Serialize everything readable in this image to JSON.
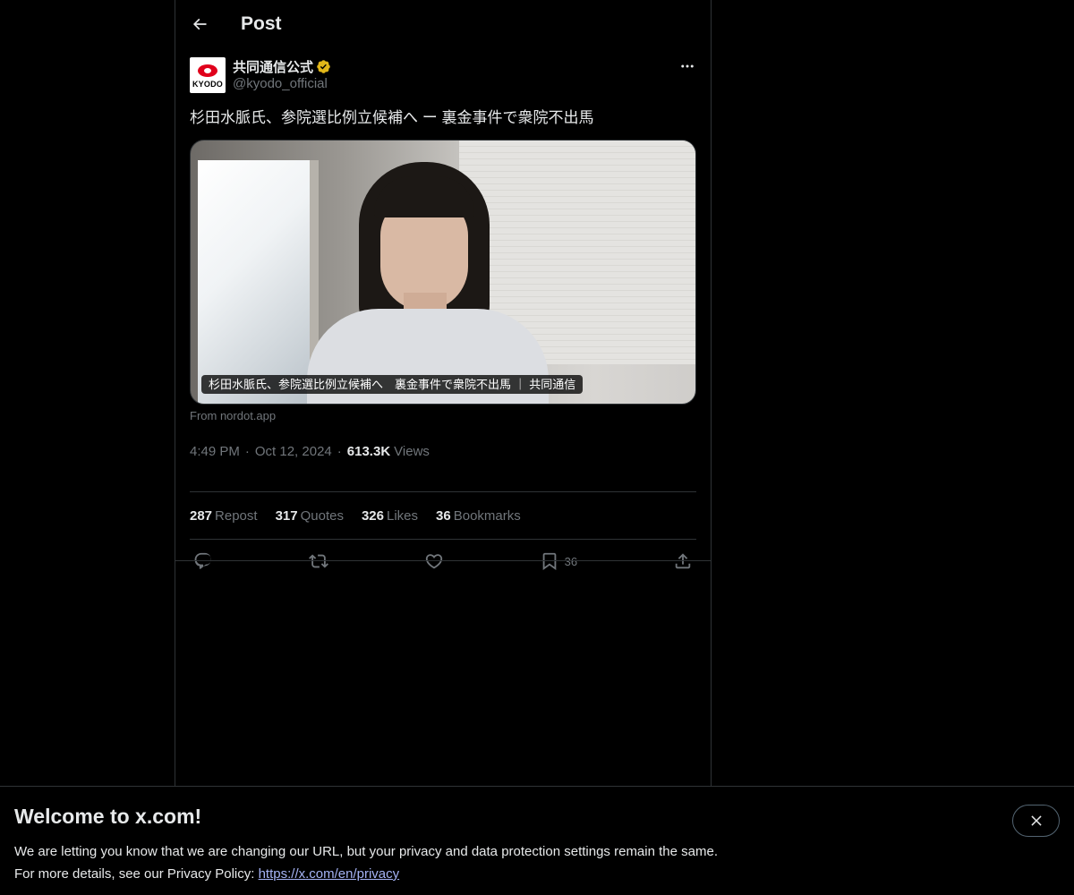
{
  "header": {
    "title": "Post"
  },
  "post": {
    "author": {
      "display_name": "共同通信公式",
      "handle": "@kyodo_official",
      "avatar_text": "KYODO"
    },
    "text": "杉田水脈氏、参院選比例立候補へ ー 裏金事件で衆院不出馬",
    "media": {
      "caption": "杉田水脈氏、参院選比例立候補へ　裏金事件で衆院不出馬 ｜ 共同通信",
      "source": "From nordot.app"
    },
    "time": "4:49 PM",
    "date": "Oct 12, 2024",
    "dot": "·",
    "views_count": "613.3K",
    "views_label": "Views",
    "stats": [
      {
        "num": "287",
        "label": "Repost"
      },
      {
        "num": "317",
        "label": "Quotes"
      },
      {
        "num": "326",
        "label": "Likes"
      },
      {
        "num": "36",
        "label": "Bookmarks"
      }
    ],
    "bookmark_count": "36"
  },
  "banner": {
    "title": "Welcome to x.com!",
    "line1": "We are letting you know that we are changing our URL, but your privacy and data protection settings remain the same.",
    "line2_prefix": "For more details, see our Privacy Policy: ",
    "link": "https://x.com/en/privacy"
  },
  "colors": {
    "background": "#000000",
    "text": "#e7e9ea",
    "muted": "#71767b",
    "border": "#2f3336",
    "verified_gold": "#e2b719",
    "link": "#a5b3f5"
  },
  "icons": {
    "back": "arrow-left-icon",
    "more": "more-horizontal-icon",
    "verified": "verified-badge-icon",
    "reply": "reply-icon",
    "repost": "repost-icon",
    "like": "heart-icon",
    "bookmark": "bookmark-icon",
    "share": "share-icon",
    "close": "close-icon"
  }
}
